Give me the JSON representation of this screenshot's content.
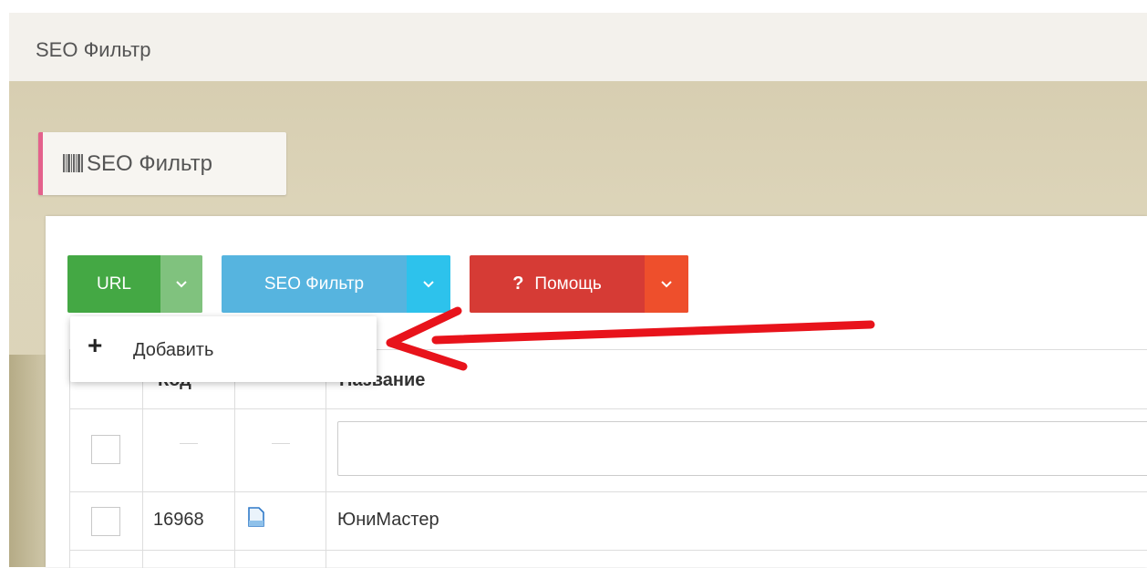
{
  "page": {
    "title": "SEO Фильтр",
    "section_tab": "SEO Фильтр"
  },
  "toolbar": {
    "url_label": "URL",
    "seo_filter_label": "SEO Фильтр",
    "help_icon": "?",
    "help_label": "Помощь"
  },
  "dropdown": {
    "items": [
      {
        "icon": "+",
        "label": "Добавить"
      }
    ]
  },
  "table": {
    "columns": {
      "code": "Код",
      "name": "Название"
    },
    "filter_dash": "—",
    "rows": [
      {
        "code": "16968",
        "name": "ЮниМастер"
      }
    ]
  },
  "colors": {
    "url_button": "#44a844",
    "seo_button": "#56b4df",
    "help_button": "#d63b35",
    "accent_tab": "#e4618c",
    "arrow": "#e8131b"
  }
}
